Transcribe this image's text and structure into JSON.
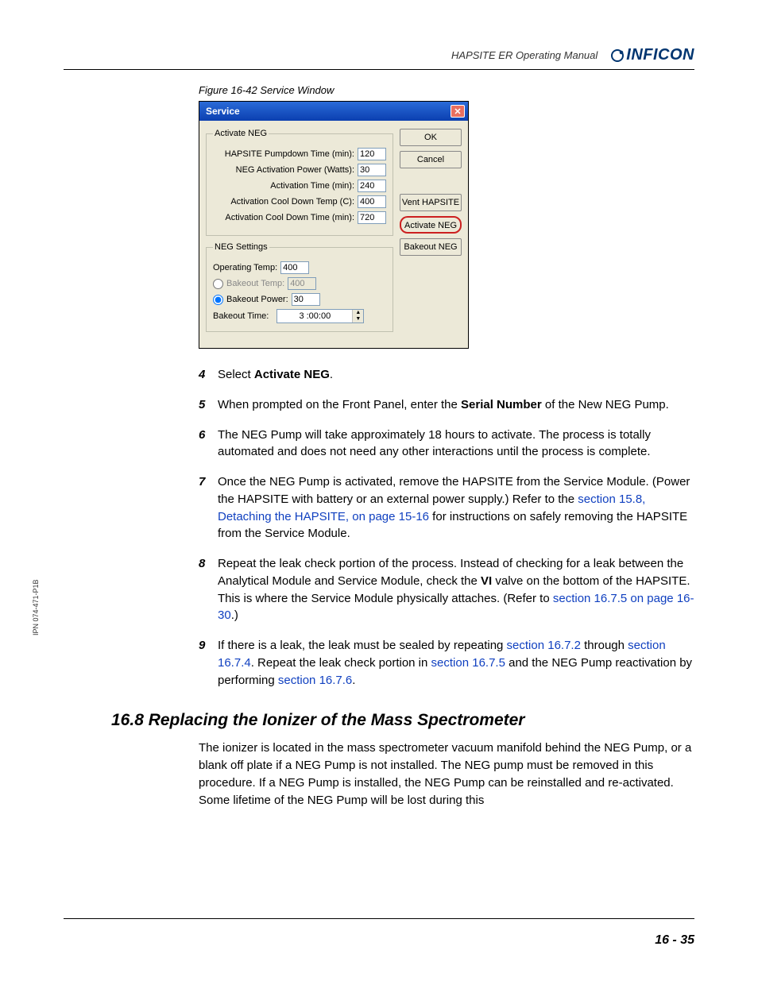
{
  "header": {
    "manual_name": "HAPSITE ER Operating Manual",
    "brand": "INFICON"
  },
  "figure_caption": "Figure 16-42  Service Window",
  "dialog": {
    "title": "Service",
    "activate_neg": {
      "legend": "Activate NEG",
      "pumpdown_label": "HAPSITE Pumpdown Time (min):",
      "pumpdown_value": "120",
      "power_label": "NEG Activation Power (Watts):",
      "power_value": "30",
      "act_time_label": "Activation Time (min):",
      "act_time_value": "240",
      "cool_temp_label": "Activation Cool Down Temp (C):",
      "cool_temp_value": "400",
      "cool_time_label": "Activation Cool Down Time (min):",
      "cool_time_value": "720"
    },
    "neg_settings": {
      "legend": "NEG Settings",
      "op_temp_label": "Operating Temp:",
      "op_temp_value": "400",
      "bakeout_temp_label": "Bakeout Temp:",
      "bakeout_temp_value": "400",
      "bakeout_power_label": "Bakeout Power:",
      "bakeout_power_value": "30",
      "bakeout_time_label": "Bakeout Time:",
      "bakeout_time_value": "3 :00:00"
    },
    "buttons": {
      "ok": "OK",
      "cancel": "Cancel",
      "vent": "Vent HAPSITE",
      "activate": "Activate NEG",
      "bakeout": "Bakeout NEG"
    }
  },
  "steps": {
    "s4_a": "Select ",
    "s4_b": "Activate NEG",
    "s4_c": ".",
    "s5_a": "When prompted on the Front Panel, enter the ",
    "s5_b": "Serial Number",
    "s5_c": " of the New NEG Pump.",
    "s6": "The NEG Pump will take approximately 18 hours to activate. The process is totally automated and does not need any other interactions until the process is complete.",
    "s7_a": "Once the NEG Pump is activated, remove the HAPSITE from the Service Module. (Power the HAPSITE with battery or an external power supply.) Refer to the ",
    "s7_link": "section 15.8, Detaching the HAPSITE, on page 15-16",
    "s7_b": " for instructions on safely removing the HAPSITE from the Service Module.",
    "s8_a": "Repeat the leak check portion of the process. Instead of checking for a leak between the Analytical Module and Service Module, check the ",
    "s8_b": "VI",
    "s8_c": " valve on the bottom of the HAPSITE. This is where the Service Module physically attaches. (Refer to ",
    "s8_link": "section 16.7.5 on page 16-30",
    "s8_d": ".)",
    "s9_a": "If there is a leak, the leak must be sealed by repeating ",
    "s9_l1": "section 16.7.2",
    "s9_b": " through ",
    "s9_l2": "section 16.7.4",
    "s9_c": ". Repeat the leak check portion in ",
    "s9_l3": "section 16.7.5",
    "s9_d": " and the NEG Pump reactivation by performing ",
    "s9_l4": "section 16.7.6",
    "s9_e": "."
  },
  "section": {
    "heading": "16.8  Replacing the Ionizer of the Mass Spectrometer",
    "para": "The ionizer is located in the mass spectrometer vacuum manifold behind the NEG Pump, or a blank off plate if a NEG Pump is not installed. The NEG pump must be removed in this procedure. If a NEG Pump is installed, the NEG Pump can be reinstalled and re-activated. Some lifetime of the NEG Pump will be lost during this"
  },
  "side": "IPN 074-471-P1B",
  "page_num": "16 - 35",
  "nums": {
    "n4": "4",
    "n5": "5",
    "n6": "6",
    "n7": "7",
    "n8": "8",
    "n9": "9"
  }
}
